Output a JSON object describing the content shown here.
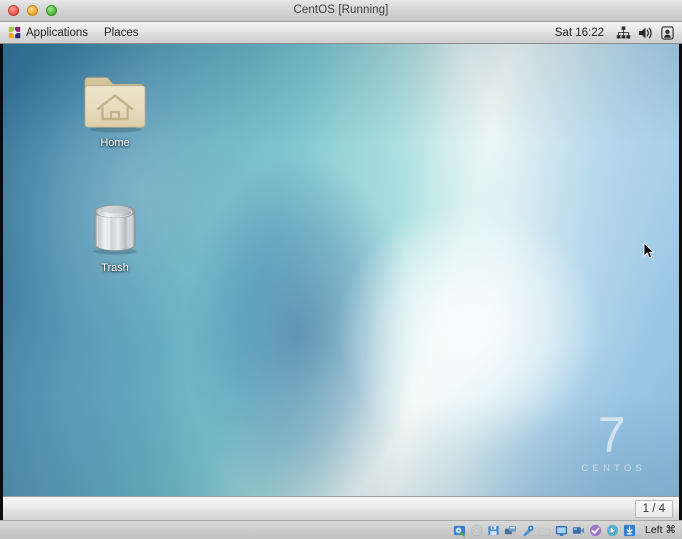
{
  "host_window": {
    "title": "CentOS [Running]",
    "controls": [
      {
        "name": "close",
        "color": "#e8564a"
      },
      {
        "name": "minimize",
        "color": "#e8a32a"
      },
      {
        "name": "maximize",
        "color": "#45ba33"
      }
    ]
  },
  "guest": {
    "os": "CentOS 7",
    "top_panel": {
      "menus": [
        {
          "label": "Applications",
          "icon": "centos-logo-icon"
        },
        {
          "label": "Places",
          "icon": null
        }
      ],
      "clock": "Sat 16:22",
      "tray": [
        {
          "name": "network-icon",
          "label": "Network"
        },
        {
          "name": "volume-icon",
          "label": "Volume"
        },
        {
          "name": "power-user-icon",
          "label": "System"
        }
      ]
    },
    "desktop": {
      "icons": [
        {
          "label": "Home",
          "icon": "home-folder-icon"
        },
        {
          "label": "Trash",
          "icon": "trash-bin-icon"
        }
      ],
      "watermark": {
        "number": "7",
        "word": "CENTOS"
      },
      "wallpaper_colors": {
        "deep_blue": "#2f6f95",
        "teal": "#68b4c4",
        "highlight": "#f4fbf7",
        "light_blue": "#9cc8e6"
      }
    },
    "bottom_panel": {
      "workspace_indicator": "1 / 4"
    }
  },
  "vbox_statusbar": {
    "icons": [
      {
        "name": "hard-disk-icon",
        "active": true
      },
      {
        "name": "optical-disk-icon",
        "active": false
      },
      {
        "name": "floppy-disk-icon",
        "active": true
      },
      {
        "name": "network-adapter-icon",
        "active": true
      },
      {
        "name": "usb-icon",
        "active": true
      },
      {
        "name": "shared-folders-icon",
        "active": false
      },
      {
        "name": "display-icon",
        "active": true
      },
      {
        "name": "video-capture-icon",
        "active": true
      },
      {
        "name": "guest-additions-icon",
        "active": true
      },
      {
        "name": "mouse-integration-icon",
        "active": true
      },
      {
        "name": "keyboard-capture-icon",
        "active": true
      }
    ],
    "host_key_label": "Left",
    "host_key_symbol": "⌘"
  }
}
